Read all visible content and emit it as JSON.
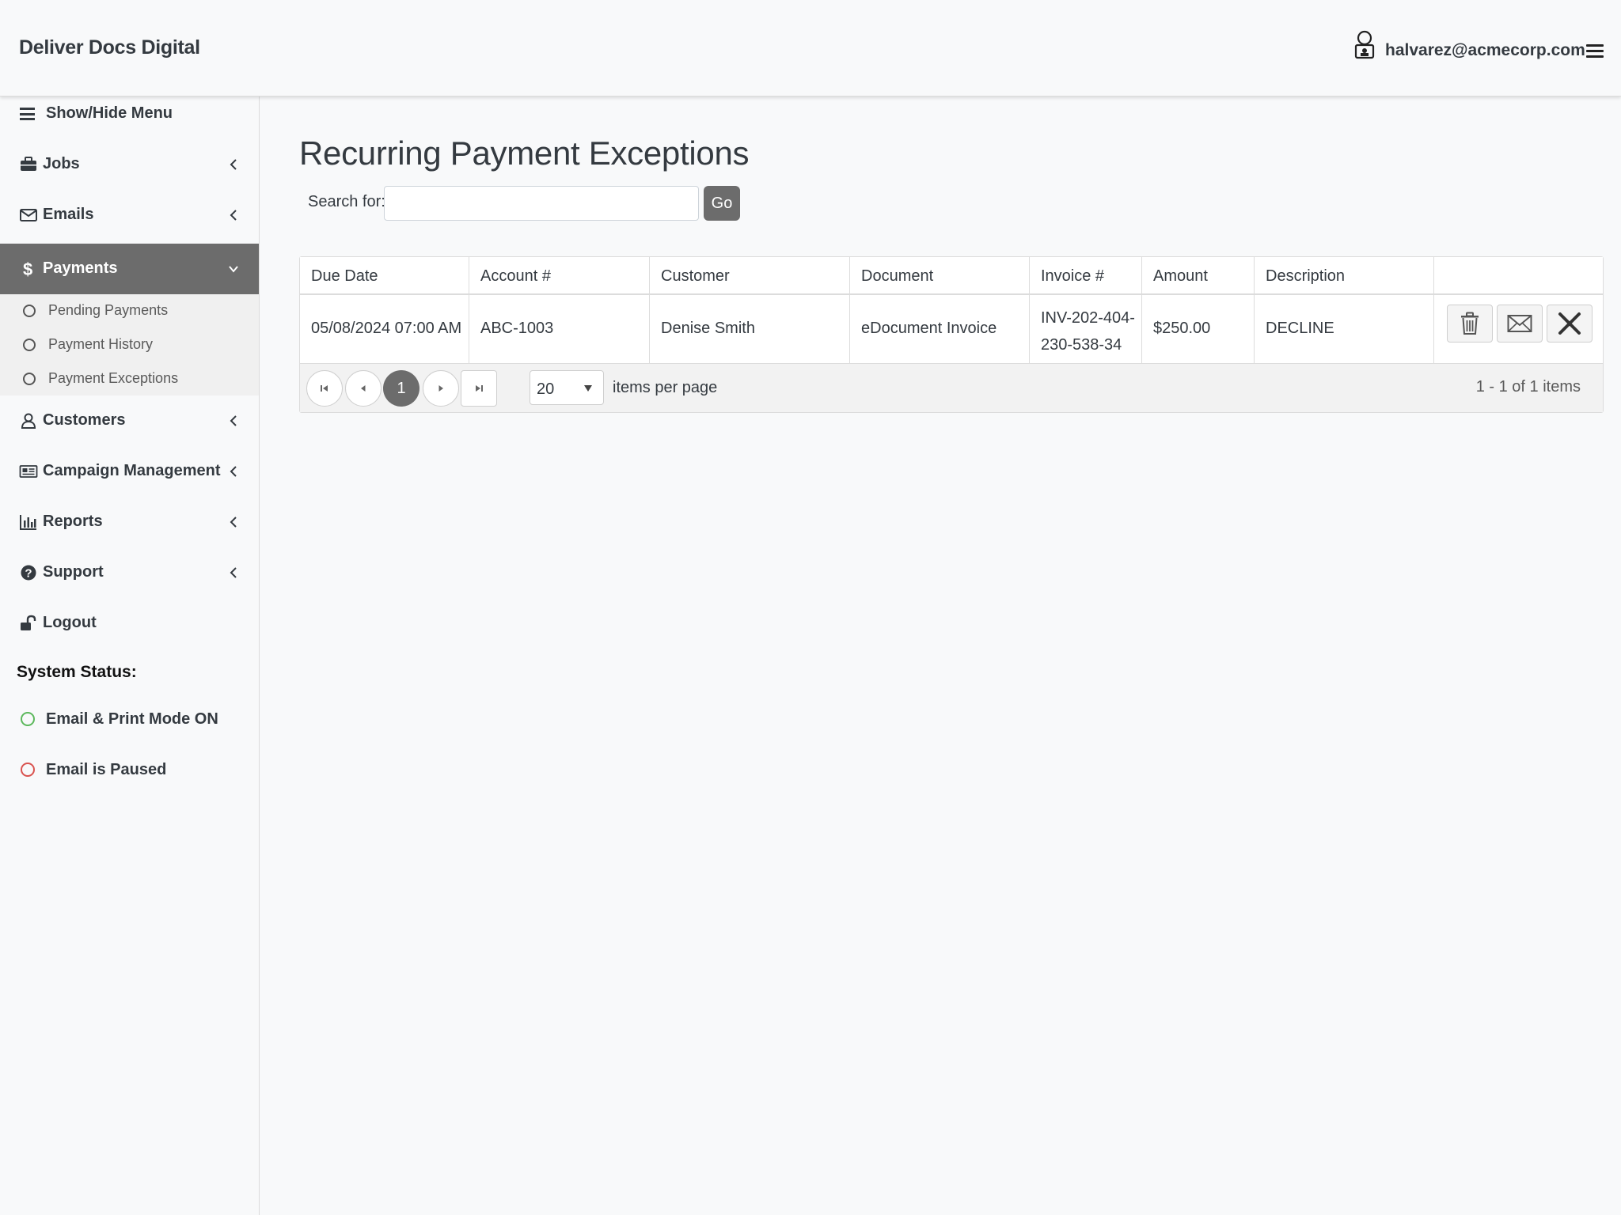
{
  "header": {
    "brand": "Deliver Docs Digital",
    "user_email": "halvarez@acmecorp.com"
  },
  "sidebar": {
    "toggle_label": "Show/Hide Menu",
    "items": [
      {
        "label": "Jobs",
        "icon": "briefcase-icon"
      },
      {
        "label": "Emails",
        "icon": "envelope-icon"
      },
      {
        "label": "Payments",
        "icon": "dollar-icon",
        "active": true
      },
      {
        "label": "Customers",
        "icon": "user-icon"
      },
      {
        "label": "Campaign Management",
        "icon": "newspaper-icon"
      },
      {
        "label": "Reports",
        "icon": "bar-chart-icon"
      },
      {
        "label": "Support",
        "icon": "question-circle-icon"
      },
      {
        "label": "Logout",
        "icon": "unlock-icon"
      }
    ],
    "payments_submenu": [
      {
        "label": "Pending Payments"
      },
      {
        "label": "Payment History"
      },
      {
        "label": "Payment Exceptions"
      }
    ],
    "system_status": {
      "title": "System Status:",
      "items": [
        {
          "label": "Email & Print Mode ON",
          "color": "#5cb85c"
        },
        {
          "label": "Email is Paused",
          "color": "#d9534f"
        }
      ]
    }
  },
  "main": {
    "title": "Recurring Payment Exceptions",
    "search": {
      "label": "Search for:",
      "value": "",
      "placeholder": "",
      "go_label": "Go"
    },
    "table": {
      "columns": [
        "Due Date",
        "Account #",
        "Customer",
        "Document",
        "Invoice #",
        "Amount",
        "Description"
      ],
      "rows": [
        {
          "due_date": "05/08/2024 07:00 AM",
          "account": "ABC-1003",
          "customer": "Denise Smith",
          "document": "eDocument Invoice",
          "invoice_line1": "INV-202-404-",
          "invoice_line2": "230-538-34",
          "amount": "$250.00",
          "description": "DECLINE"
        }
      ],
      "row_actions": [
        "trash-icon",
        "envelope-icon",
        "close-icon"
      ]
    },
    "pager": {
      "current_page": "1",
      "page_size": "20",
      "page_size_label": "items per page",
      "info": "1 - 1 of 1 items"
    }
  },
  "colors": {
    "active_nav_bg": "#6c6c6c",
    "status_on": "#5cb85c",
    "status_paused": "#d9534f",
    "go_button_bg": "#6c6c6c"
  }
}
